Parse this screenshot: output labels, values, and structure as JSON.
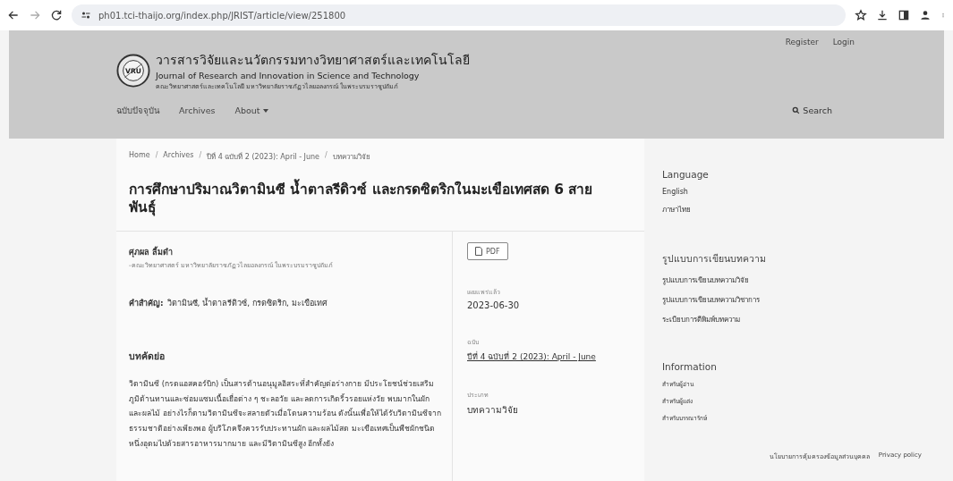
{
  "browser": {
    "url": "ph01.tci-thaijo.org/index.php/JRIST/article/view/251800"
  },
  "header": {
    "user_links": [
      "Register",
      "Login"
    ],
    "logo_text": "VRU",
    "title_th": "วารสารวิจัยและนวัตกรรมทางวิทยาศาสตร์และเทคโนโลยี",
    "title_en": "Journal of Research and Innovation in Science and Technology",
    "subtitle": "คณะวิทยาศาสตร์และเทคโนโลยี มหาวิทยาลัยราชภัฏวไลยอลงกรณ์ ในพระบรมราชูปถัมภ์",
    "nav": [
      {
        "label": "ฉบับปัจจุบัน",
        "dropdown": false
      },
      {
        "label": "Archives",
        "dropdown": false
      },
      {
        "label": "About",
        "dropdown": true
      }
    ],
    "search": "Search"
  },
  "breadcrumb_separator": "/",
  "breadcrumb": [
    "Home",
    "Archives",
    "ปีที่ 4 ฉบับที่ 2 (2023): April - June",
    "บทความวิจัย"
  ],
  "article": {
    "title": "การศึกษาปริมาณวิตามินซี น้ำตาลรีดิวซ์ และกรดซิตริกในมะเขือเทศสด 6 สายพันธุ์",
    "author": "ศุภผล ลิ้มดำ",
    "affiliation": "-คณะวิทยาศาสตร์ มหาวิทยาลัยราชภัฏวไลยอลงกรณ์ ในพระบรมราชูปถัมภ์",
    "keywords_label": "คำสำคัญ:",
    "keywords": "วิตามินซี, น้ำตาลรีดิวซ์, กรดซิตริก, มะเขือเทศ",
    "abstract_heading": "บทคัดย่อ",
    "abstract": "วิตามินซี (กรดแอสคอร์บิก) เป็นสารต้านอนุมูลอิสระที่สำคัญต่อร่างกาย มีประโยชน์ช่วยเสริมภูมิต้านทานและซ่อมแซมเนื้อเยื่อต่าง ๆ ชะลอวัย และลดการเกิดริ้วรอยแห่งวัย พบมากในผักและผลไม้ อย่างไรก็ตามวิตามินซีจะสลายตัวเมื่อโดนความร้อน ดังนั้นเพื่อให้ได้รับวิตามินซีจากธรรมชาติอย่างเพียงพอ ผู้บริโภคจึงควรรับประทานผัก และผลไม้สด มะเขือเทศเป็นพืชผักชนิดหนึ่งอุดมไปด้วยสารอาหารมากมาย และมีวิตามินซีสูง อีกทั้งยัง",
    "pdf": "PDF",
    "meta": [
      {
        "label": "เผยแพร่แล้ว",
        "value": "2023-06-30",
        "link": false
      },
      {
        "label": "ฉบับ",
        "value": "ปีที่ 4 ฉบับที่ 2 (2023): April - June",
        "link": true
      },
      {
        "label": "ประเภท",
        "value": "บทความวิจัย",
        "link": false
      }
    ]
  },
  "sidebar": [
    {
      "heading": "Language",
      "items": [
        "English",
        "ภาษาไทย"
      ]
    },
    {
      "heading": "รูปแบบการเขียนบทความ",
      "items": [
        "รูปแบบการเขียนบทความวิจัย",
        "รูปแบบการเขียนบทความวิชาการ",
        "ระเบียบการตีพิมพ์บทความ"
      ]
    },
    {
      "heading": "Information",
      "items": [
        "สำหรับผู้อ่าน",
        "สำหรับผู้แต่ง",
        "สำหรับบรรณารักษ์"
      ]
    }
  ],
  "footer_links": [
    "นโยบายการคุ้มครองข้อมูลส่วนบุคคล",
    "Privacy policy"
  ]
}
